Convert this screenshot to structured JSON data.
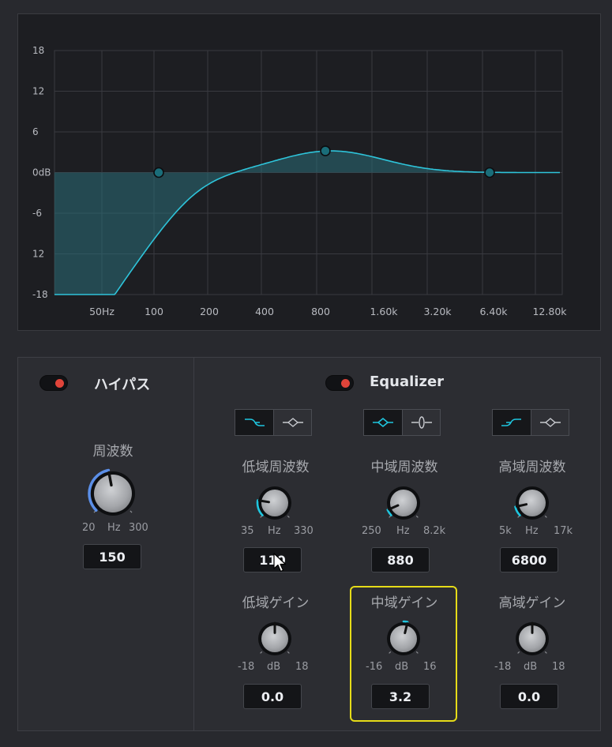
{
  "graph": {
    "y_labels": [
      "18",
      "12",
      "6",
      "0dB",
      "-6",
      "12",
      "-18"
    ],
    "x_labels": [
      "50Hz",
      "100",
      "200",
      "400",
      "800",
      "1.60k",
      "3.20k",
      "6.40k",
      "12.80k"
    ],
    "curve_color": "#2ec4da",
    "fill_color": "#2a6e78",
    "bands": [
      {
        "name": "low",
        "freq_hz": 110,
        "gain_db": 0.0
      },
      {
        "name": "mid",
        "freq_hz": 880,
        "gain_db": 3.2
      },
      {
        "name": "high",
        "freq_hz": 6800,
        "gain_db": 0.0
      }
    ]
  },
  "highpass": {
    "title": "ハイパス",
    "enabled": true,
    "freq": {
      "label": "周波数",
      "min": "20",
      "unit": "Hz",
      "max": "300",
      "value": "150",
      "ring_fraction": 0.46
    }
  },
  "equalizer": {
    "title": "Equalizer",
    "enabled": true,
    "low_freq": {
      "label": "低域周波数",
      "min": "35",
      "unit": "Hz",
      "max": "330",
      "value": "110",
      "ring_fraction": 0.2
    },
    "mid_freq": {
      "label": "中域周波数",
      "min": "250",
      "unit": "Hz",
      "max": "8.2k",
      "value": "880",
      "ring_fraction": 0.08
    },
    "high_freq": {
      "label": "高域周波数",
      "min": "5k",
      "unit": "Hz",
      "max": "17k",
      "value": "6800",
      "ring_fraction": 0.12
    },
    "low_gain": {
      "label": "低域ゲイン",
      "min": "-18",
      "unit": "dB",
      "max": "18",
      "value": "0.0",
      "ring_fraction": 0.0
    },
    "mid_gain": {
      "label": "中域ゲイン",
      "min": "-16",
      "unit": "dB",
      "max": "16",
      "value": "3.2",
      "ring_fraction": 0.1
    },
    "high_gain": {
      "label": "高域ゲイン",
      "min": "-18",
      "unit": "dB",
      "max": "18",
      "value": "0.0",
      "ring_fraction": 0.0
    },
    "low_shape": {
      "options": [
        "low-shelf-icon",
        "bell-icon"
      ],
      "selected": 0
    },
    "mid_shape": {
      "options": [
        "bell-icon",
        "notch-icon"
      ],
      "selected": 0
    },
    "high_shape": {
      "options": [
        "high-shelf-icon",
        "bell-icon"
      ],
      "selected": 0
    }
  },
  "colors": {
    "accent": "#1fc6df",
    "highpass_ring": "#5b8fe8",
    "highlight": "#e6dc18",
    "toggle_on": "#e0443a"
  }
}
